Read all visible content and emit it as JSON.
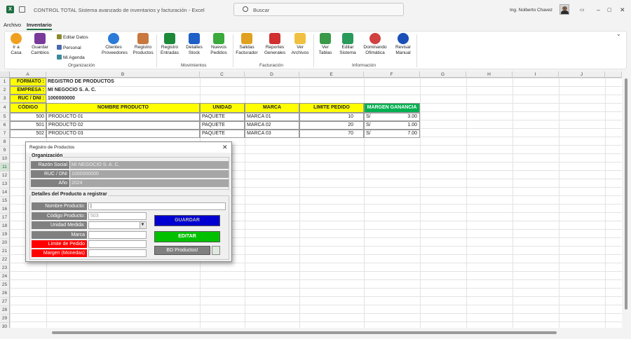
{
  "app": {
    "title": "CONTROL TOTAL Sistema avanzado de inventarios y facturación  -  Excel",
    "search_placeholder": "Buscar",
    "user": "Ing. Nolberto Chavez"
  },
  "menu": {
    "archivo": "Archivo",
    "inventario": "Inventario"
  },
  "ribbon": {
    "ir_casa": "Ir a Casa",
    "guardar": "Guardar Cambios",
    "editar_datos": "Editar Datos",
    "personal": "Personal",
    "mi_agenda": "Mi Agenda",
    "clientes": "Clientes Proveedores",
    "registro_productos": "Registro Productos",
    "registro_entradas": "Registro Entradas",
    "detalles_stock": "Detalles Stock",
    "nuevos_pedidos": "Nuevos Pedidos",
    "salidas": "Salidas Facturador",
    "reportes": "Reportes Generales",
    "ver_archivos": "Ver Archivos",
    "ver_tablas": "Ver Tablas",
    "editar_sistema": "Editar Sistema",
    "dominando": "Dominando Ofimática",
    "revisar": "Revisar Manual",
    "grp_organizacion": "Organización",
    "grp_movimientos": "Movimientos",
    "grp_facturacion": "Facturación",
    "grp_informacion": "Información",
    "icon_colors": {
      "home": "#f0a020",
      "save": "#7a3a9a",
      "clients": "#2a7ad8",
      "products": "#c8783c",
      "green": "#1d8a3a",
      "blue": "#1f5fc8",
      "money": "#e0a020",
      "pdf": "#d03030",
      "folder": "#f0c040",
      "books": "#3a9a4a",
      "edit": "#2a9a5a",
      "of": "#d04040",
      "help": "#1a4fb8"
    }
  },
  "sheet": {
    "columns": [
      "A",
      "B",
      "C",
      "D",
      "E",
      "F",
      "G",
      "H",
      "I",
      "J"
    ],
    "rows": [
      "1",
      "2",
      "3",
      "4",
      "5",
      "6",
      "7",
      "8",
      "9",
      "10",
      "11",
      "12",
      "13",
      "14",
      "15",
      "16",
      "17",
      "18",
      "19",
      "20",
      "21",
      "22",
      "23",
      "24",
      "25",
      "26",
      "27",
      "28",
      "29",
      "30"
    ],
    "labels": {
      "formato": "FORMATO :",
      "empresa": "EMPRESA :",
      "ruc": "RUC / DNI :"
    },
    "values": {
      "formato": "REGISTRO DE PRODUCTOS",
      "empresa": "MI NEGOCIO S. A. C.",
      "ruc": "1000000000"
    },
    "headers": [
      "CÓDIGO",
      "NOMBRE PRODUCTO",
      "UNIDAD",
      "MARCA",
      "LIMITE PEDIDO",
      "MARGEN GANANCIA"
    ],
    "data": [
      {
        "codigo": "500",
        "nombre": "PRODUCTO 01",
        "unidad": "PAQUETE",
        "marca": "MARCA 01",
        "limite": "10",
        "moneda": "S/",
        "margen": "3.00"
      },
      {
        "codigo": "501",
        "nombre": "PRODUCTO 02",
        "unidad": "PAQUETE",
        "marca": "MARCA 02",
        "limite": "20",
        "moneda": "S/",
        "margen": "1.00"
      },
      {
        "codigo": "502",
        "nombre": "PRODUCTO 03",
        "unidad": "PAQUETE",
        "marca": "MARCA 03",
        "limite": "70",
        "moneda": "S/",
        "margen": "7.00"
      }
    ]
  },
  "dialog": {
    "title": "Registro de Productos",
    "org_frame": "Organización",
    "razon_label": "Razón Social",
    "razon_value": "MI NEGOCIO S. A. C.",
    "ruc_label": "RUC / DNI",
    "ruc_value": "1000000000",
    "anio_label": "Año",
    "anio_value": "2024",
    "detalles_frame": "Detalles del Producto a registrar",
    "nombre_label": "Nombre Producto:",
    "nombre_value": "|",
    "codigo_label": "Código Producto:",
    "codigo_value": "503",
    "unidad_label": "Unidad Medida:",
    "marca_label": "Marca",
    "limite_label": "Límite de Pedido",
    "margen_label": "Margen (Monedas)",
    "guardar": "GUARDAR",
    "editar": "EDITAR",
    "bd": "BD Productos!"
  }
}
